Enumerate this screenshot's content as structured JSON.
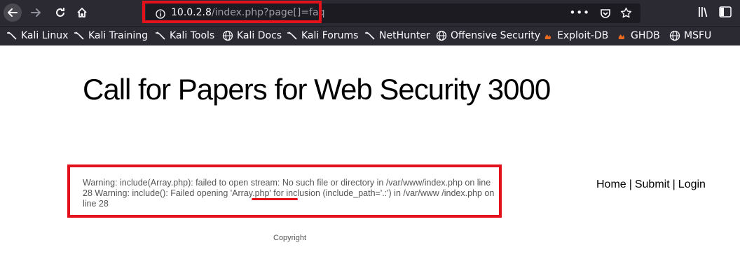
{
  "browser": {
    "url_host": "10.0.2.8",
    "url_path": "/index.php?page[]=faq",
    "overflow_menu": "•••"
  },
  "bookmarks": [
    {
      "label": "Kali Linux",
      "icon": "kali-dragon-icon"
    },
    {
      "label": "Kali Training",
      "icon": "kali-dragon-icon"
    },
    {
      "label": "Kali Tools",
      "icon": "kali-dragon-icon"
    },
    {
      "label": "Kali Docs",
      "icon": "globe-icon"
    },
    {
      "label": "Kali Forums",
      "icon": "kali-dragon-icon"
    },
    {
      "label": "NetHunter",
      "icon": "kali-dragon-icon"
    },
    {
      "label": "Offensive Security",
      "icon": "globe-icon"
    },
    {
      "label": "Exploit-DB",
      "icon": "exploit-db-icon"
    },
    {
      "label": "GHDB",
      "icon": "exploit-db-icon"
    },
    {
      "label": "MSFU",
      "icon": "globe-icon"
    }
  ],
  "page": {
    "title": "Call for Papers for Web Security 3000",
    "warning_part1": "Warning: include(Array.php): failed to open stream: No such file or directory in /var/www/index.php on line 28 Warning: include(): Failed opening ",
    "warning_highlight": "'Array.php'",
    "warning_part2": " for inclusion (include_path='.:') in /var/www /index.php on line 28",
    "nav": {
      "home": "Home",
      "submit": "Submit",
      "login": "Login",
      "sep": "|"
    },
    "footer": "Copyright"
  },
  "colors": {
    "annotation": "#e3111b",
    "chrome": "#2b2a33"
  }
}
